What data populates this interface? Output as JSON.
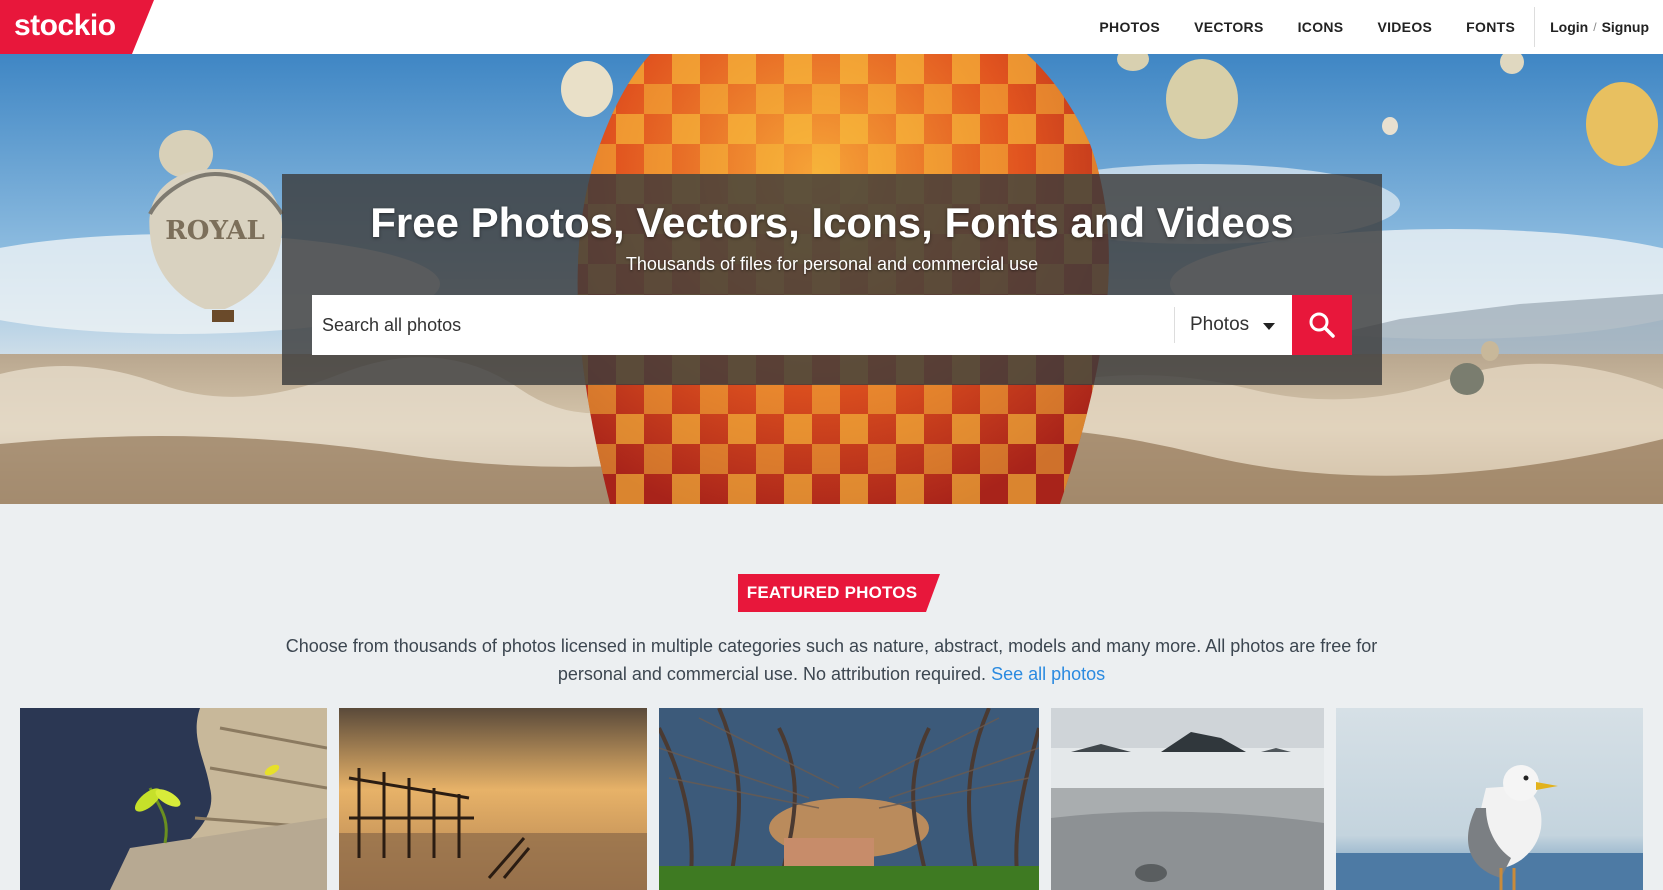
{
  "brand": {
    "logo_text": "stockio",
    "accent": "#e8173b"
  },
  "nav": {
    "items": [
      {
        "label": "PHOTOS"
      },
      {
        "label": "VECTORS"
      },
      {
        "label": "ICONS"
      },
      {
        "label": "VIDEOS"
      },
      {
        "label": "FONTS"
      }
    ],
    "login_label": "Login",
    "signup_label": "Signup",
    "separator": "/"
  },
  "hero": {
    "title": "Free Photos, Vectors, Icons, Fonts and Videos",
    "subtitle": "Thousands of files for personal and commercial use",
    "search_placeholder": "Search all photos",
    "category_selected": "Photos",
    "search_icon": "search-icon",
    "background": "hot-air-balloons-over-landscape",
    "balloon_text": "ROYAL"
  },
  "featured": {
    "badge_label": "FEATURED PHOTOS",
    "description": "Choose from thousands of photos licensed in multiple categories such as nature, abstract, models and many more. All photos are free for personal and commercial use. No attribution required.",
    "link_label": "See all photos",
    "link_color": "#2a8ae0",
    "photos": [
      {
        "subject": "flower-on-wood"
      },
      {
        "subject": "pier-at-sunset"
      },
      {
        "subject": "tree-lined-path"
      },
      {
        "subject": "misty-beach-rocks"
      },
      {
        "subject": "seagull"
      }
    ]
  }
}
